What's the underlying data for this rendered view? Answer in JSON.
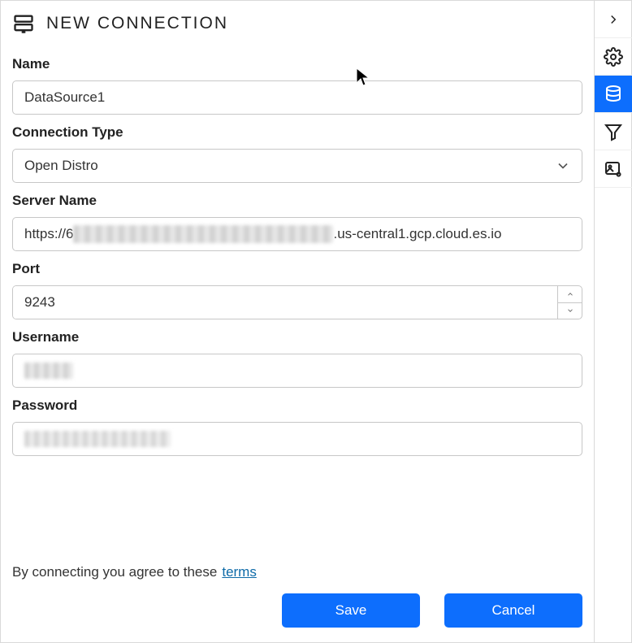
{
  "header": {
    "title": "NEW CONNECTION"
  },
  "fields": {
    "name": {
      "label": "Name",
      "value": "DataSource1"
    },
    "connection_type": {
      "label": "Connection Type",
      "value": "Open Distro"
    },
    "server_name": {
      "label": "Server Name",
      "prefix": "https://6",
      "suffix": ".us-central1.gcp.cloud.es.io"
    },
    "port": {
      "label": "Port",
      "value": "9243"
    },
    "username": {
      "label": "Username"
    },
    "password": {
      "label": "Password"
    }
  },
  "footer": {
    "agree_text": "By connecting you agree to these",
    "terms_label": "terms",
    "save_label": "Save",
    "cancel_label": "Cancel"
  },
  "sidebar": {
    "items": [
      {
        "name": "collapse",
        "active": false
      },
      {
        "name": "settings",
        "active": false
      },
      {
        "name": "datasource",
        "active": true
      },
      {
        "name": "filter",
        "active": false
      },
      {
        "name": "image-settings",
        "active": false
      }
    ]
  }
}
